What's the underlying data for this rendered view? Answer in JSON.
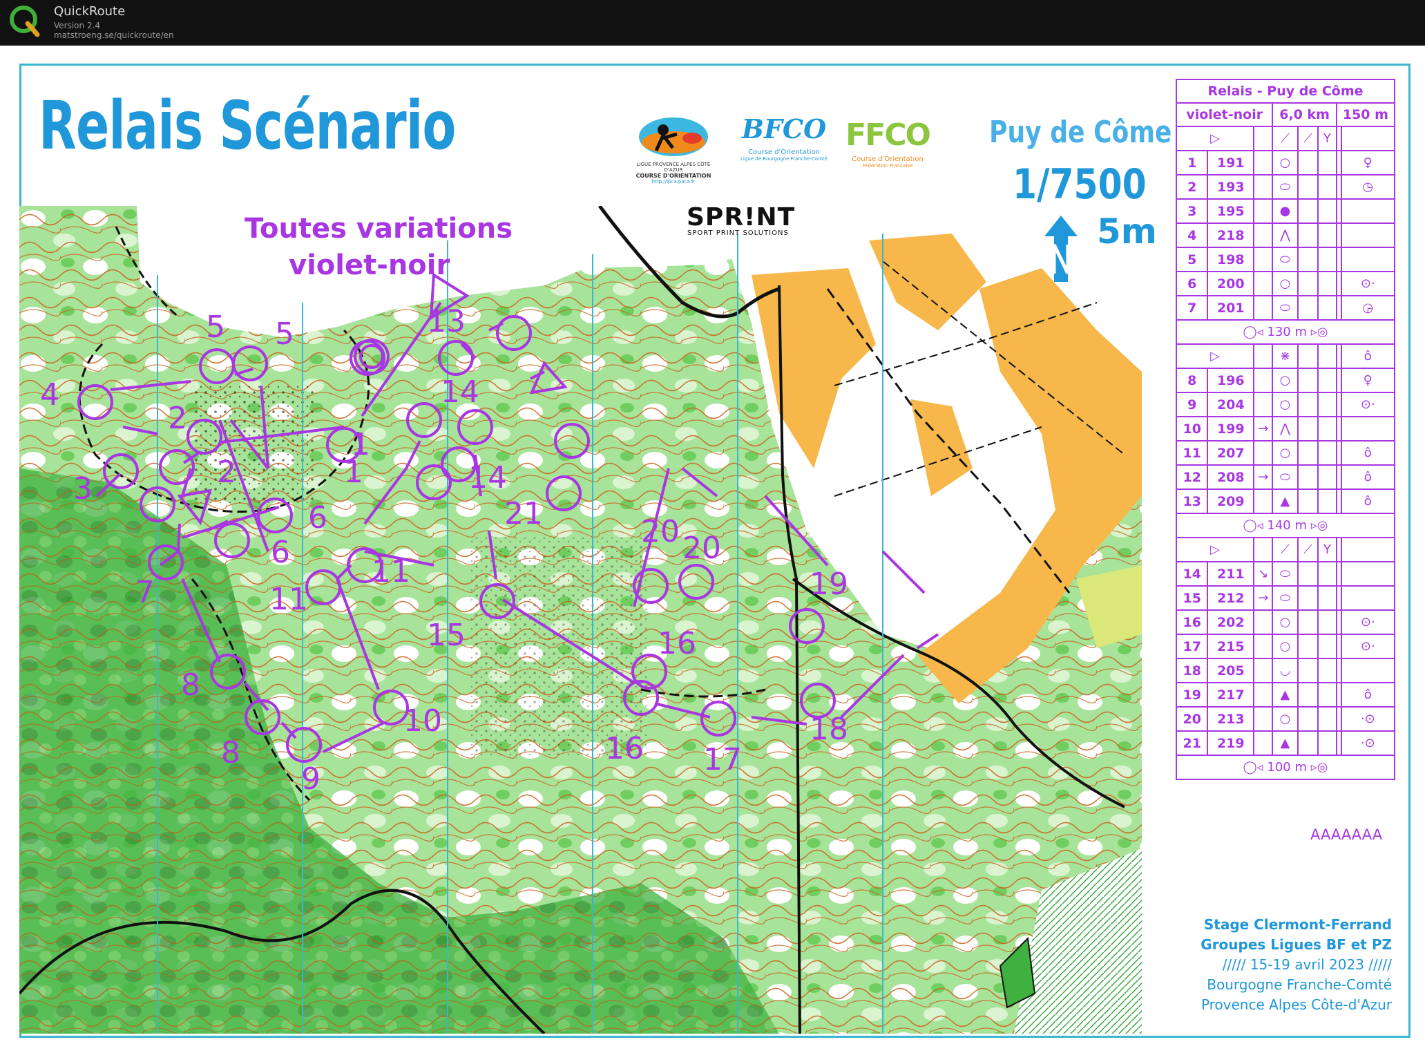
{
  "window": {
    "app_name": "QuickRoute",
    "version": "Version 2.4",
    "url": "matstroeng.se/quickroute/en"
  },
  "header": {
    "title": "Relais Scénario",
    "subtitle_line1": "Toutes variations",
    "subtitle_line2": "violet-noir",
    "venue": "Puy de Côme",
    "scale": "1/7500",
    "equidistance": "5m"
  },
  "logos": {
    "logo1_lines": [
      "LIGUE PROVENCE ALPES CÔTE D'AZUR",
      "COURSE D'ORIENTATION",
      "http://lpca.paca.fr"
    ],
    "logo2_text": "BFCO",
    "logo2_lines": [
      "Course d'Orientation",
      "Ligue de Bourgogne Franche-Comté"
    ],
    "logo3_text": "FFCO",
    "logo3_lines": [
      "Course d'Orientation",
      "Fédération Française"
    ],
    "sprint_text": "SPR!NT",
    "sprint_sub": "SPORT PRINT SOLUTIONS"
  },
  "control_descriptions": {
    "title": "Relais  - Puy de Côme",
    "course": "violet-noir",
    "length": "6,0 km",
    "climb": "150 m",
    "section1": [
      {
        "num": "1",
        "code": "191",
        "dir": "",
        "feature": "○",
        "detail": "♀"
      },
      {
        "num": "2",
        "code": "193",
        "dir": "",
        "feature": "⬭",
        "detail": "◷"
      },
      {
        "num": "3",
        "code": "195",
        "dir": "",
        "feature": "●",
        "detail": ""
      },
      {
        "num": "4",
        "code": "218",
        "dir": "",
        "feature": "⋀",
        "detail": ""
      },
      {
        "num": "5",
        "code": "198",
        "dir": "",
        "feature": "⬭",
        "detail": ""
      },
      {
        "num": "6",
        "code": "200",
        "dir": "",
        "feature": "○",
        "detail": "⊙·"
      },
      {
        "num": "7",
        "code": "201",
        "dir": "",
        "feature": "⬭",
        "detail": "◶"
      }
    ],
    "marked_route_1": "130 m",
    "section2": [
      {
        "num": "8",
        "code": "196",
        "dir": "",
        "feature": "○",
        "detail": "♀"
      },
      {
        "num": "9",
        "code": "204",
        "dir": "",
        "feature": "○",
        "detail": "⊙·"
      },
      {
        "num": "10",
        "code": "199",
        "dir": "→",
        "feature": "⋀",
        "detail": ""
      },
      {
        "num": "11",
        "code": "207",
        "dir": "",
        "feature": "○",
        "detail": "ô"
      },
      {
        "num": "12",
        "code": "208",
        "dir": "→",
        "feature": "⬭",
        "detail": "ô"
      },
      {
        "num": "13",
        "code": "209",
        "dir": "",
        "feature": "▲",
        "detail": "ô"
      }
    ],
    "marked_route_2": "140 m",
    "section3": [
      {
        "num": "14",
        "code": "211",
        "dir": "↘",
        "feature": "⬭",
        "detail": ""
      },
      {
        "num": "15",
        "code": "212",
        "dir": "→",
        "feature": "⬭",
        "detail": ""
      },
      {
        "num": "16",
        "code": "202",
        "dir": "",
        "feature": "○",
        "detail": "⊙·"
      },
      {
        "num": "17",
        "code": "215",
        "dir": "",
        "feature": "○",
        "detail": "⊙·"
      },
      {
        "num": "18",
        "code": "205",
        "dir": "",
        "feature": "◡",
        "detail": ""
      },
      {
        "num": "19",
        "code": "217",
        "dir": "",
        "feature": "▲",
        "detail": "ô"
      },
      {
        "num": "20",
        "code": "213",
        "dir": "",
        "feature": "○",
        "detail": "·⊙"
      },
      {
        "num": "21",
        "code": "219",
        "dir": "",
        "feature": "▲",
        "detail": "·⊙"
      }
    ],
    "marked_route_3": "100 m"
  },
  "footer_code": "AAAAAAA",
  "info": {
    "line1": "Stage Clermont-Ferrand",
    "line2": "Groupes Ligues BF et PZ",
    "line3": "///// 15-19 avril 2023 /////",
    "line4": "Bourgogne Franche-Comté",
    "line5": "Provence Alpes Côte-d'Azur"
  },
  "map_controls": [
    {
      "n": "1"
    },
    {
      "n": "1"
    },
    {
      "n": "2"
    },
    {
      "n": "2"
    },
    {
      "n": "3"
    },
    {
      "n": "4"
    },
    {
      "n": "5"
    },
    {
      "n": "5"
    },
    {
      "n": "6"
    },
    {
      "n": "6"
    },
    {
      "n": "7"
    },
    {
      "n": "8"
    },
    {
      "n": "8"
    },
    {
      "n": "9"
    },
    {
      "n": "10"
    },
    {
      "n": "11"
    },
    {
      "n": "11"
    },
    {
      "n": "13"
    },
    {
      "n": "14"
    },
    {
      "n": "14"
    },
    {
      "n": "15"
    },
    {
      "n": "16"
    },
    {
      "n": "16"
    },
    {
      "n": "17"
    },
    {
      "n": "18"
    },
    {
      "n": "19"
    },
    {
      "n": "20"
    },
    {
      "n": "20"
    },
    {
      "n": "21"
    }
  ],
  "colors": {
    "course": "#a836e3",
    "title_blue": "#1f97d9",
    "forest_green": "#86d97c",
    "open_yellow": "#f7b74b",
    "contour_brown": "#c8661e",
    "meridian": "#39b6d0"
  }
}
